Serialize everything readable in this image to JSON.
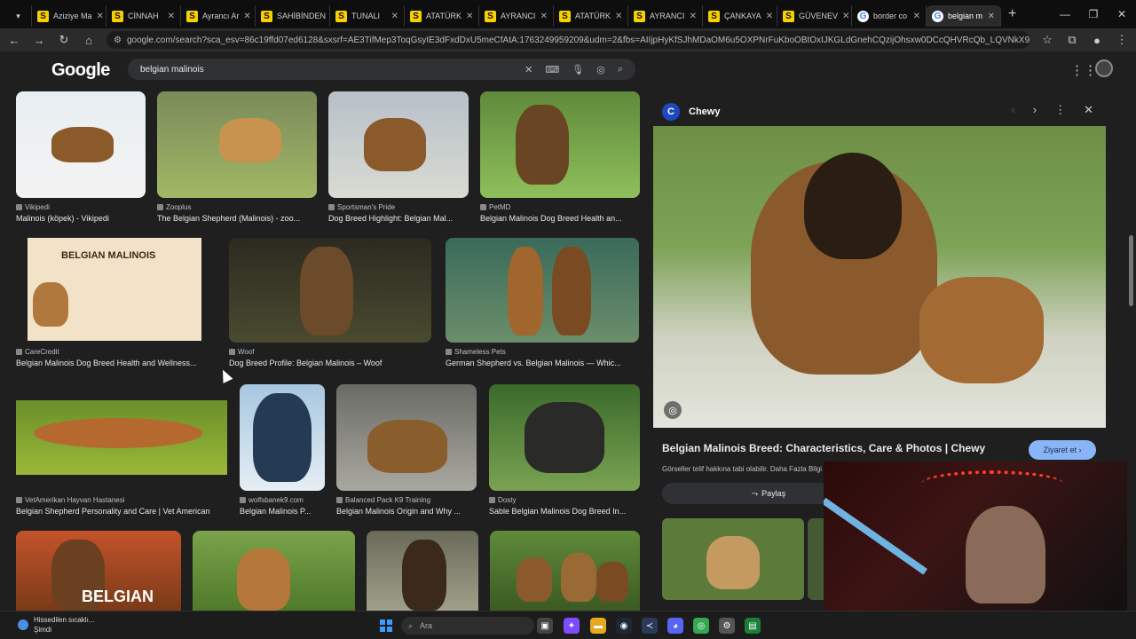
{
  "tabs": [
    {
      "label": "Aziziye Ma",
      "icon": "S"
    },
    {
      "label": "CİNNAH",
      "icon": "S"
    },
    {
      "label": "Ayrancı Ar",
      "icon": "S"
    },
    {
      "label": "SAHİBİNDEN",
      "icon": "S"
    },
    {
      "label": "TUNALI",
      "icon": "S"
    },
    {
      "label": "ATATÜRK",
      "icon": "S"
    },
    {
      "label": "AYRANCI",
      "icon": "S"
    },
    {
      "label": "ATATÜRK",
      "icon": "S"
    },
    {
      "label": "AYRANCI",
      "icon": "S"
    },
    {
      "label": "ÇANKAYA",
      "icon": "S"
    },
    {
      "label": "GÜVENEV",
      "icon": "S"
    },
    {
      "label": "border co",
      "icon": "G"
    },
    {
      "label": "belgian m",
      "icon": "G"
    }
  ],
  "address": {
    "host": "google.com",
    "url": "google.com/search?sca_esv=86c19ffd07ed6128&sxsrf=AE3TifMep3ToqGsyIE3dFxdDxU5meCfAtA:1763249959209&udm=2&fbs=AIIjpHyKfSJhMDaOM6u5OXPNrFuKboOBtOxIJKGLdGnehCQzijOhsxw0DCcQHVRcQb_LQVNkX9hAj60JyrbPXhSkhD..."
  },
  "search": {
    "logo": "Google",
    "query": "belgian malinois"
  },
  "results": [
    {
      "source": "Vikipedi",
      "title": "Malinois (köpek) - Vikipedi"
    },
    {
      "source": "Zooplus",
      "title": "The Belgian Shepherd (Malinois) - zoo..."
    },
    {
      "source": "Sportsman's Pride",
      "title": "Dog Breed Highlight: Belgian Mal..."
    },
    {
      "source": "PetMD",
      "title": "Belgian Malinois Dog Breed Health an..."
    },
    {
      "source": "CareCredit",
      "title": "Belgian Malinois Dog Breed Health and Wellness...",
      "poster": "BELGIAN MALINOIS"
    },
    {
      "source": "Woof",
      "title": "Dog Breed Profile: Belgian Malinois – Woof"
    },
    {
      "source": "Shameless Pets",
      "title": "German Shepherd vs. Belgian Malinois — Whic..."
    },
    {
      "source": "VetAmerikan Hayvan Hastanesi",
      "title": "Belgian Shepherd Personality and Care | Vet American"
    },
    {
      "source": "wolfsbanek9.com",
      "title": "Belgian Malinois P..."
    },
    {
      "source": "Balanced Pack K9 Training",
      "title": "Belgian Malinois Origin and Why ..."
    },
    {
      "source": "Dosty",
      "title": "Sable Belgian Malinois Dog Breed In..."
    }
  ],
  "bottom_row_text": "BELGIAN",
  "panel": {
    "source": "Chewy",
    "title": "Belgian Malinois Breed: Characteristics, Care & Photos | Chewy",
    "visit": "Ziyaret et",
    "note": "Görseller telif hakkına tabi olabilir. Daha Fazla Bilgi",
    "share": "Paylaş"
  },
  "taskbar": {
    "weather_line1": "Hissedilen sıcaklı...",
    "weather_line2": "Şimdi",
    "search": "Ara"
  },
  "colors": {
    "bg": "#1f1f1f",
    "accent": "#8ab4f8",
    "tab_icon": "#f7d000"
  }
}
